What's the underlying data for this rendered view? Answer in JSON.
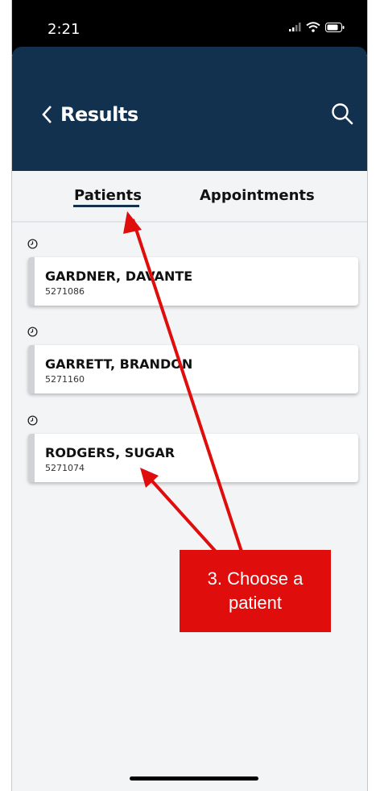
{
  "status_bar": {
    "time": "2:21"
  },
  "header": {
    "back_label": "Results"
  },
  "tabs": [
    {
      "label": "Patients",
      "active": true
    },
    {
      "label": "Appointments",
      "active": false
    }
  ],
  "patients": [
    {
      "name": "GARDNER, DAVANTE",
      "id": "5271086"
    },
    {
      "name": "GARRETT, BRANDON",
      "id": "5271160"
    },
    {
      "name": "RODGERS, SUGAR",
      "id": "5271074"
    }
  ],
  "annotation": {
    "line1": "3. Choose a",
    "line2": "patient"
  },
  "colors": {
    "header": "#12314f",
    "callout": "#e00d0d",
    "background": "#f3f4f6"
  }
}
